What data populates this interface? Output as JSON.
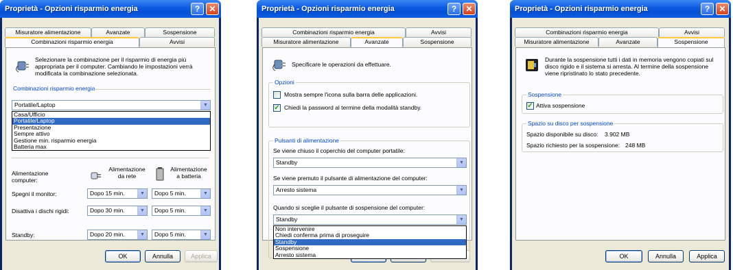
{
  "colors": {
    "title_bar": "#0a5ae0",
    "selection": "#316ac5",
    "group_label": "#0046d5",
    "active_tab_accent": "#ffc83c",
    "check": "#21a121"
  },
  "window1": {
    "title": "Proprietà - Opzioni risparmio energia",
    "tabs": [
      "Misuratore alimentazione",
      "Avanzate",
      "Sospensione",
      "Combinazioni risparmio energia",
      "Avvisi"
    ],
    "description": "Selezionare la combinazione per il risparmio di energia più appropriata per il computer. Cambiando le impostazioni verrà modificata la combinazione selezionata.",
    "group_label": "Combinazioni risparmio energia",
    "combo_value": "Portatile/Laptop",
    "options": [
      "Casa/Ufficio",
      "Portatile/Laptop",
      "Presentazione",
      "Sempre attivo",
      "Gestione min. risparmio energia",
      "Batteria max"
    ],
    "selected_index": 1,
    "settings_header": "Alimentazione computer:",
    "ac_label": "Alimentazione da rete",
    "battery_label": "Alimentazione a batteria",
    "rows": [
      {
        "label": "Spegni il monitor:",
        "ac": "Dopo 15 min.",
        "battery": "Dopo 5 min."
      },
      {
        "label": "Disattiva i dischi rigidi:",
        "ac": "Dopo 30 min.",
        "battery": "Dopo 5 min."
      },
      {
        "label": "Standby:",
        "ac": "Dopo 20 min.",
        "battery": "Dopo 5 min."
      }
    ],
    "buttons": {
      "ok": "OK",
      "cancel": "Annulla",
      "apply": "Applica"
    }
  },
  "window2": {
    "title": "Proprietà - Opzioni risparmio energia",
    "tabs": [
      "Combinazioni risparmio energia",
      "Avvisi",
      "Misuratore alimentazione",
      "Avanzate",
      "Sospensione"
    ],
    "description": "Specificare le operazioni da effettuare.",
    "options_group": "Opzioni",
    "checkbox1": "Mostra sempre l'icona sulla barra delle applicazioni.",
    "checkbox1_checked": false,
    "checkbox2": "Chiedi la password al termine della modalità standby.",
    "checkbox2_checked": true,
    "power_group": "Pulsanti di alimentazione",
    "q1": "Se viene chiuso il coperchio del computer portatile:",
    "q1_value": "Standby",
    "q2": "Se viene premuto il pulsante di alimentazione del computer:",
    "q2_value": "Arresto sistema",
    "q3": "Quando si sceglie il pulsante di sospensione del computer:",
    "q3_value": "Standby",
    "options": [
      "Non intervenire",
      "Chiedi conferma prima di proseguire",
      "Standby",
      "Sospensione",
      "Arresto sistema"
    ],
    "selected_index": 2
  },
  "window3": {
    "title": "Proprietà - Opzioni risparmio energia",
    "tabs": [
      "Combinazioni risparmio energia",
      "Avvisi",
      "Misuratore alimentazione",
      "Avanzate",
      "Sospensione"
    ],
    "description": "Durante la sospensione tutti i dati in memoria vengono copiati sul disco rigido e il sistema si arresta. Al termine della sospensione viene ripristinato lo stato precedente.",
    "group1": "Sospensione",
    "checkbox": "Attiva sospensione",
    "checkbox_checked": true,
    "group2": "Spazio su disco per sospensione",
    "free_label": "Spazio disponibile su disco:",
    "free_value": "3.902 MB",
    "required_label": "Spazio richiesto per la sospensione:",
    "required_value": "248 MB",
    "buttons": {
      "ok": "OK",
      "cancel": "Annulla",
      "apply": "Applica"
    }
  },
  "title_buttons": {
    "help": "?",
    "close": "✕"
  }
}
